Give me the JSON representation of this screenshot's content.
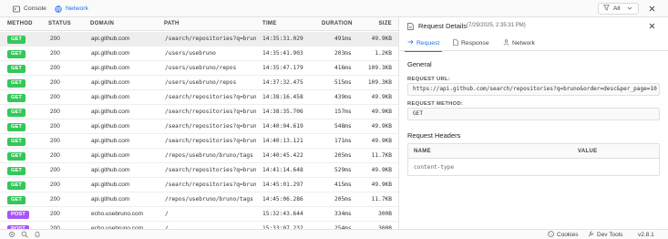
{
  "tabs": [
    {
      "label": "Console",
      "icon": "console-icon"
    },
    {
      "label": "Network",
      "icon": "network-icon",
      "active": true
    }
  ],
  "filter": {
    "label": "All",
    "icon": "filter-icon"
  },
  "columns": [
    "METHOD",
    "STATUS",
    "DOMAIN",
    "PATH",
    "TIME",
    "DURATION",
    "SIZE"
  ],
  "rows": [
    {
      "method": "GET",
      "status": "200",
      "domain": "api.github.com",
      "path": "/search/repositories?q=brun...",
      "time": "14:35:31.029",
      "duration": "491ms",
      "size": "49.9KB"
    },
    {
      "method": "GET",
      "status": "200",
      "domain": "api.github.com",
      "path": "/users/usebruno",
      "time": "14:35:41.903",
      "duration": "203ms",
      "size": "1.2KB"
    },
    {
      "method": "GET",
      "status": "200",
      "domain": "api.github.com",
      "path": "/users/usebruno/repos",
      "time": "14:35:47.179",
      "duration": "416ms",
      "size": "109.3KB"
    },
    {
      "method": "GET",
      "status": "200",
      "domain": "api.github.com",
      "path": "/users/usebruno/repos",
      "time": "14:37:32.475",
      "duration": "515ms",
      "size": "109.3KB"
    },
    {
      "method": "GET",
      "status": "200",
      "domain": "api.github.com",
      "path": "/search/repositories?q=brun...",
      "time": "14:38:16.458",
      "duration": "439ms",
      "size": "49.9KB"
    },
    {
      "method": "GET",
      "status": "200",
      "domain": "api.github.com",
      "path": "/search/repositories?q=brun...",
      "time": "14:38:35.706",
      "duration": "157ms",
      "size": "49.9KB"
    },
    {
      "method": "GET",
      "status": "200",
      "domain": "api.github.com",
      "path": "/search/repositories?q=brun...",
      "time": "14:40:04.619",
      "duration": "548ms",
      "size": "49.9KB"
    },
    {
      "method": "GET",
      "status": "200",
      "domain": "api.github.com",
      "path": "/search/repositories?q=brun...",
      "time": "14:40:13.121",
      "duration": "171ms",
      "size": "49.9KB"
    },
    {
      "method": "GET",
      "status": "200",
      "domain": "api.github.com",
      "path": "/repos/usebruno/bruno/tags",
      "time": "14:40:45.422",
      "duration": "205ms",
      "size": "11.7KB"
    },
    {
      "method": "GET",
      "status": "200",
      "domain": "api.github.com",
      "path": "/search/repositories?q=brun...",
      "time": "14:41:14.648",
      "duration": "529ms",
      "size": "49.9KB"
    },
    {
      "method": "GET",
      "status": "200",
      "domain": "api.github.com",
      "path": "/search/repositories?q=brun...",
      "time": "14:45:01.297",
      "duration": "415ms",
      "size": "49.9KB"
    },
    {
      "method": "GET",
      "status": "200",
      "domain": "api.github.com",
      "path": "/repos/usebruno/bruno/tags",
      "time": "14:45:06.286",
      "duration": "205ms",
      "size": "11.7KB"
    },
    {
      "method": "POST",
      "status": "200",
      "domain": "echo.usebruno.com",
      "path": "/",
      "time": "15:32:43.644",
      "duration": "334ms",
      "size": "300B"
    },
    {
      "method": "POST",
      "status": "200",
      "domain": "echo.usebruno.com",
      "path": "/",
      "time": "15:33:07.232",
      "duration": "254ms",
      "size": "300B"
    }
  ],
  "details": {
    "title": "Request Details",
    "date": "(7/29/2025, 2:35:31 PM)",
    "tabs": [
      "Request",
      "Response",
      "Network"
    ],
    "general_title": "General",
    "url_label": "REQUEST URL:",
    "url_value": "https://api.github.com/search/repositories?q=bruno&order=desc&per_page=10",
    "method_label": "REQUEST METHOD:",
    "method_value": "GET",
    "headers_title": "Request Headers",
    "headers_columns": [
      "NAME",
      "VALUE"
    ],
    "headers_rows": [
      {
        "name": "content-type",
        "value": ""
      }
    ]
  },
  "statusbar": {
    "cookies_label": "Cookies",
    "devtools_label": "Dev Tools",
    "version": "v2.8.1"
  },
  "colors": {
    "accent": "#1a73e8",
    "get": "#34c759",
    "post": "#a855f7"
  }
}
